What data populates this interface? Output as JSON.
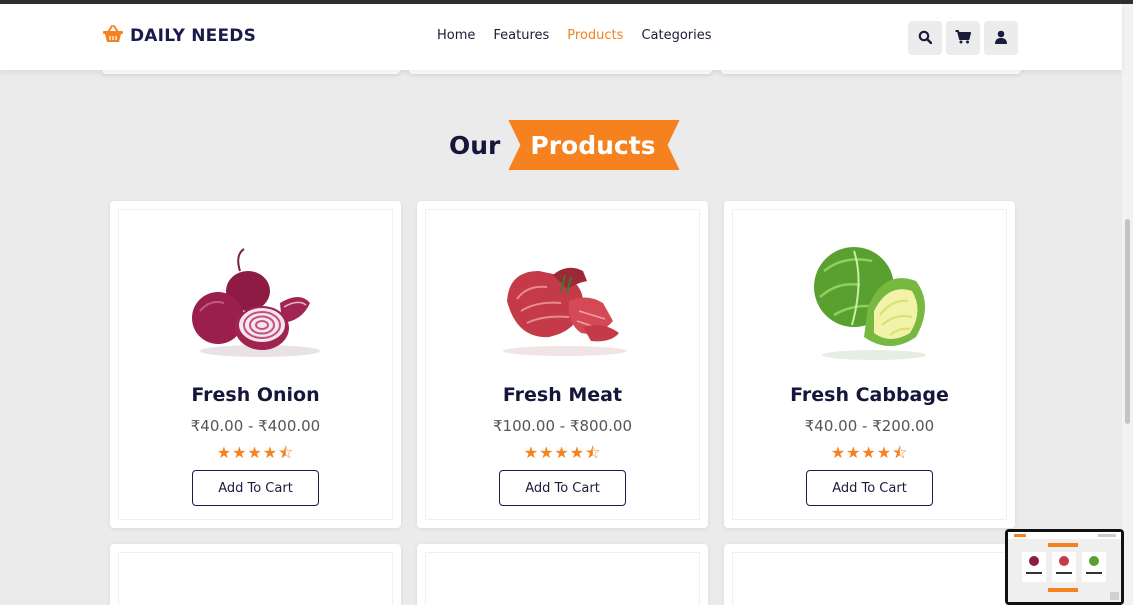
{
  "brand": {
    "name": "DAILY NEEDS",
    "icon": "basket-icon",
    "accent": "#f5821f",
    "dark": "#16163b"
  },
  "nav": {
    "items": [
      {
        "label": "Home",
        "active": false
      },
      {
        "label": "Features",
        "active": false
      },
      {
        "label": "Products",
        "active": true
      },
      {
        "label": "Categories",
        "active": false
      }
    ]
  },
  "header_icons": [
    "search-icon",
    "cart-icon",
    "user-icon"
  ],
  "section": {
    "title_plain": "Our",
    "title_highlight": "Products"
  },
  "products": [
    {
      "name": "Fresh Onion",
      "price": "₹40.00 - ₹400.00",
      "rating": 4.5,
      "stars": "★★★★⯪",
      "button": "Add To Cart",
      "image": "onion-image"
    },
    {
      "name": "Fresh Meat",
      "price": "₹100.00 - ₹800.00",
      "rating": 4.5,
      "stars": "★★★★⯪",
      "button": "Add To Cart",
      "image": "meat-image"
    },
    {
      "name": "Fresh Cabbage",
      "price": "₹40.00 - ₹200.00",
      "rating": 4.5,
      "stars": "★★★★⯪",
      "button": "Add To Cart",
      "image": "cabbage-image"
    }
  ]
}
